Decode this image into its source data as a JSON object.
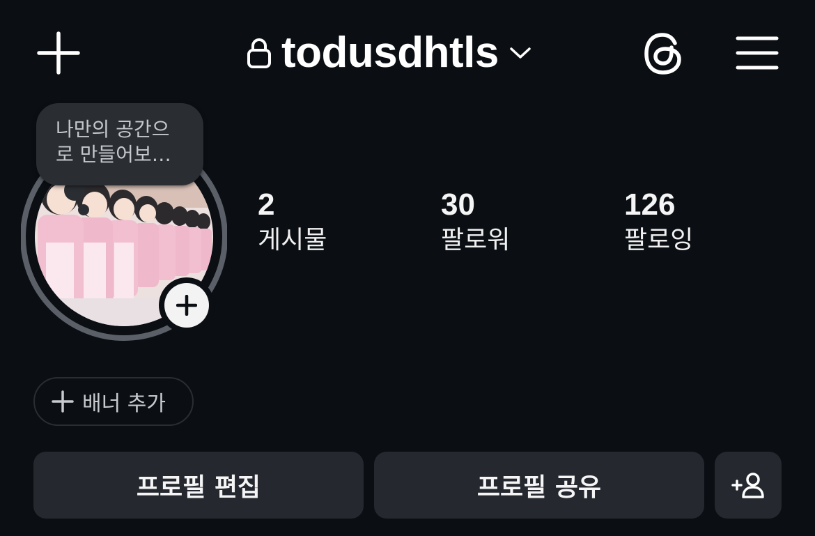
{
  "header": {
    "username": "todusdhtls",
    "create_icon": "plus-icon",
    "lock_icon": "lock-icon",
    "switch_icon": "chevron-down-icon",
    "threads_icon": "threads-icon",
    "menu_icon": "hamburger-menu-icon"
  },
  "profile": {
    "note": {
      "line1": "나만의 공간으",
      "line2": "로 만들어보…"
    },
    "avatar_icon": "profile-avatar",
    "add_story_icon": "plus-icon"
  },
  "stats": {
    "posts": {
      "value": "2",
      "label": "게시물"
    },
    "followers": {
      "value": "30",
      "label": "팔로워"
    },
    "following": {
      "value": "126",
      "label": "팔로잉"
    }
  },
  "banner": {
    "label": "배너 추가",
    "icon": "plus-icon"
  },
  "actions": {
    "edit": "프로필 편집",
    "share": "프로필 공유",
    "discover_icon": "add-person-icon"
  },
  "colors": {
    "background": "#0b0f14",
    "button": "#25292f",
    "bubble": "#2a2e33",
    "text": "#f5f5f5"
  }
}
